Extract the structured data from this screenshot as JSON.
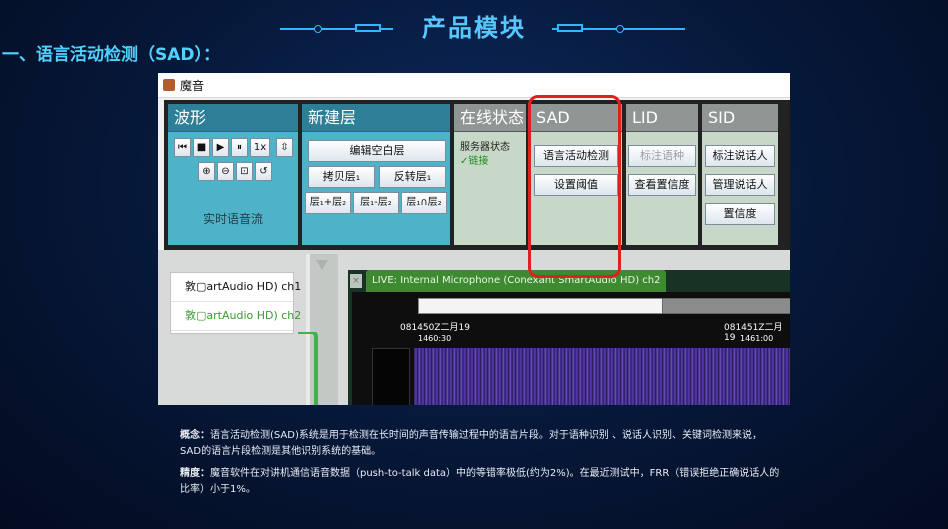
{
  "slide": {
    "title": "产品模块",
    "section_heading": "一、语言活动检测（SAD）："
  },
  "app": {
    "window_title": "魔音",
    "panels": {
      "waveform": {
        "title": "波形",
        "speed_label": "1x",
        "realtime_label": "实时语音流"
      },
      "new_layer": {
        "title": "新建层",
        "edit_blank": "编辑空白层",
        "copy_layer": "拷贝层₁",
        "invert_layer": "反转层₁",
        "union": "层₁+层₂",
        "difference": "层₁-层₂",
        "intersection": "层₁∩层₂"
      },
      "online_status": {
        "title": "在线状态",
        "server_label": "服务器状态",
        "connected": "✓链接"
      },
      "sad": {
        "title": "SAD",
        "detect_button": "语言活动检测",
        "threshold_button": "设置阈值"
      },
      "lid": {
        "title": "LID",
        "tag_language": "标注语种",
        "view_confidence": "查看置信度"
      },
      "sid": {
        "title": "SID",
        "tag_speaker": "标注说话人",
        "manage_speaker": "管理说话人",
        "confidence": "置信度"
      }
    },
    "tracks": [
      "敦▢artAudio HD) ch1",
      "敦▢artAudio HD) ch2"
    ],
    "live_tab": "LIVE: Internal Microphone (Conexant SmartAudio HD) ch2",
    "timeline": {
      "left_time": "081450Z二月19",
      "left_sub": "1460:30",
      "right_time": "081451Z二月19",
      "right_sub": "1461:00"
    }
  },
  "caption": {
    "concept_label": "概念：",
    "concept_text": "语言活动检测(SAD)系统是用于检测在长时间的声音传输过程中的语言片段。对于语种识别 、说话人识别、关键词检测来说，SAD的语言片段检测是其他识别系统的基础。",
    "accuracy_label": "精度：",
    "accuracy_text": "魔音软件在对讲机通信语音数据（push-to-talk data）中的等错率极低(约为2%)。在最近测试中，FRR（错误拒绝正确说话人的比率）小于1%。"
  }
}
